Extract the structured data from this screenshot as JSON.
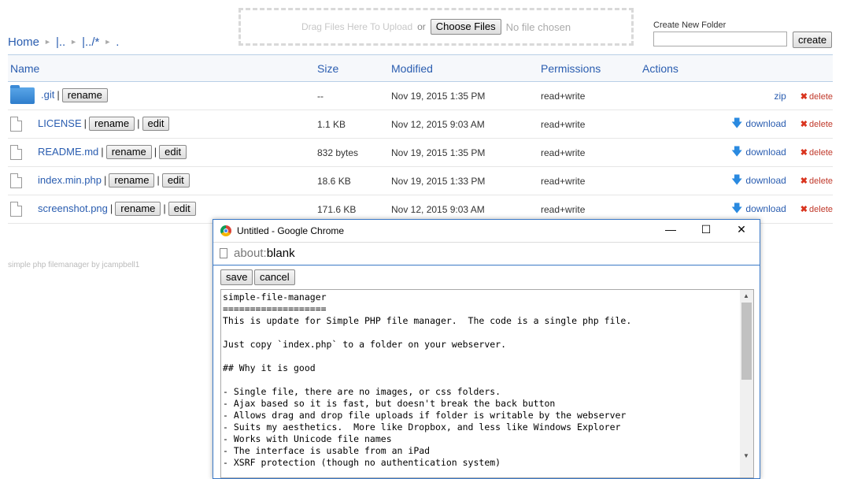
{
  "breadcrumb": {
    "home": "Home",
    "up": "|..",
    "up_all": "|../*",
    "end": "."
  },
  "upload": {
    "drag_text": "Drag Files Here To Upload",
    "or": "or",
    "choose_label": "Choose Files",
    "no_file": "No file chosen"
  },
  "new_folder": {
    "label": "Create New Folder",
    "value": "",
    "create_label": "create"
  },
  "table": {
    "headers": {
      "name": "Name",
      "size": "Size",
      "modified": "Modified",
      "permissions": "Permissions",
      "actions": "Actions"
    },
    "rows": [
      {
        "name": ".git",
        "type": "folder",
        "size": "--",
        "modified": "Nov 19, 2015 1:35 PM",
        "permissions": "read+write",
        "action": "zip"
      },
      {
        "name": "LICENSE",
        "type": "file",
        "size": "1.1 KB",
        "modified": "Nov 12, 2015 9:03 AM",
        "permissions": "read+write",
        "action": "download"
      },
      {
        "name": "README.md",
        "type": "file",
        "size": "832 bytes",
        "modified": "Nov 19, 2015 1:35 PM",
        "permissions": "read+write",
        "action": "download"
      },
      {
        "name": "index.min.php",
        "type": "file",
        "size": "18.6 KB",
        "modified": "Nov 19, 2015 1:33 PM",
        "permissions": "read+write",
        "action": "download"
      },
      {
        "name": "screenshot.png",
        "type": "file",
        "size": "171.6 KB",
        "modified": "Nov 12, 2015 9:03 AM",
        "permissions": "read+write",
        "action": "download"
      }
    ],
    "rename_label": "rename",
    "edit_label": "edit",
    "delete_label": "delete"
  },
  "footer": "simple php filemanager by jcampbell1",
  "popup": {
    "title": "Untitled - Google Chrome",
    "address_scheme": "about:",
    "address_path": "blank",
    "save_label": "save",
    "cancel_label": "cancel",
    "content": "simple-file-manager\n===================\nThis is update for Simple PHP file manager.  The code is a single php file.\n\nJust copy `index.php` to a folder on your webserver.\n\n## Why it is good\n\n- Single file, there are no images, or css folders.\n- Ajax based so it is fast, but doesn't break the back button\n- Allows drag and drop file uploads if folder is writable by the webserver\n- Suits my aesthetics.  More like Dropbox, and less like Windows Explorer\n- Works with Unicode file names\n- The interface is usable from an iPad\n- XSRF protection (though no authentication system)"
  },
  "icons": {
    "folder": "folder-icon",
    "file": "file-icon",
    "download": "download-arrow-icon",
    "delete": "red-x-icon"
  },
  "colors": {
    "link": "#2a5db0",
    "delete": "#c0392b",
    "window_border": "#3b79c7"
  }
}
